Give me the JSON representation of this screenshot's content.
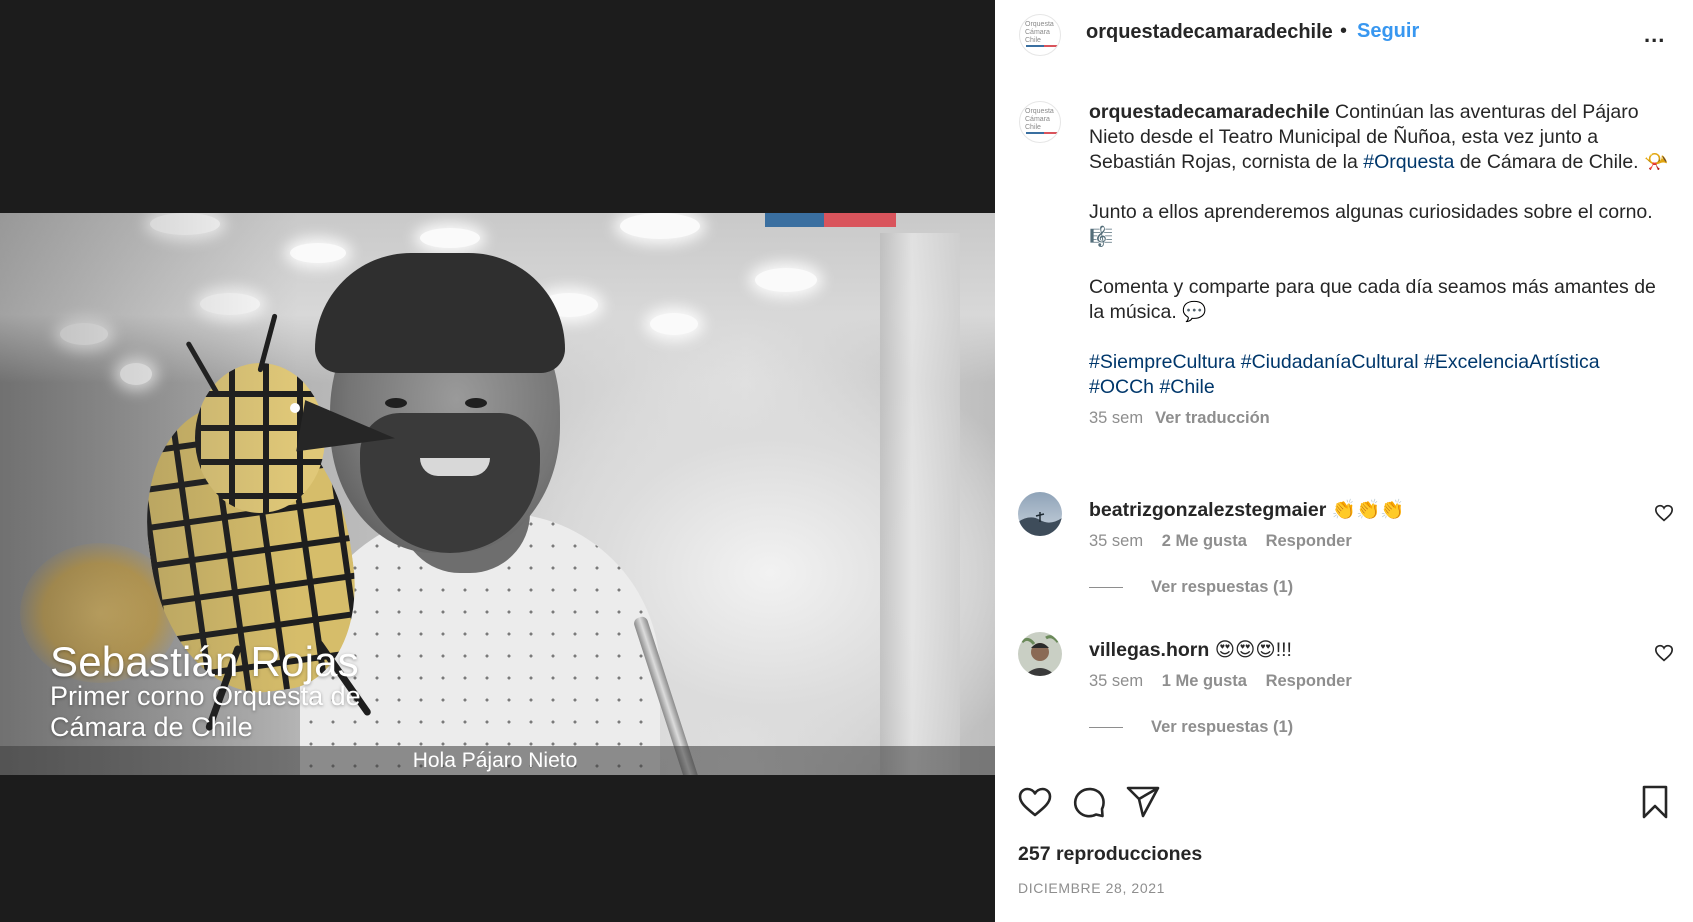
{
  "video": {
    "overlay_name": "Sebastián Rojas",
    "overlay_role": "Primer corno Orquesta de Cámara de Chile",
    "subtitle": "Hola Pájaro Nieto",
    "flag_colors": [
      "#3a6fa0",
      "#d9545c"
    ]
  },
  "header": {
    "username": "orquestadecamaradechile",
    "separator": "•",
    "follow_label": "Seguir",
    "more_label": "...",
    "avatar_logo_lines": [
      "Orquesta",
      "Cámara",
      "Chile"
    ],
    "avatar_icon": "occh-logo-icon"
  },
  "post": {
    "username": "orquestadecamaradechile",
    "paragraph1_text": "Continúan las aventuras del Pájaro Nieto desde el Teatro Municipal de Ñuñoa, esta vez junto a Sebastián Rojas, cornista de la",
    "paragraph1_tag": "#Orquesta",
    "paragraph1_end": "de Cámara de Chile. 📯",
    "paragraph2": "Junto a ellos aprenderemos algunas curiosidades sobre el corno. 🎼",
    "paragraph3": "Comenta y comparte para que cada día seamos más amantes de la música. 💬",
    "hashtags": [
      "#SiempreCultura",
      "#CiudadaníaCultural",
      "#ExcelenciaArtística",
      "#OCCh",
      "#Chile"
    ],
    "time": "35 sem",
    "translate_label": "Ver traducción"
  },
  "comments": [
    {
      "username": "beatrizgonzalezstegmaier",
      "text": "👏👏👏",
      "time": "35 sem",
      "likes": "2 Me gusta",
      "reply_label": "Responder",
      "view_replies": "Ver respuestas (1)"
    },
    {
      "username": "villegas.horn",
      "text": "😍😍😍!!!",
      "time": "35 sem",
      "likes": "1 Me gusta",
      "reply_label": "Responder",
      "view_replies": "Ver respuestas (1)"
    }
  ],
  "footer": {
    "views": "257 reproducciones",
    "date": "DICIEMBRE 28, 2021",
    "icons": [
      "heart-icon",
      "comment-icon",
      "share-icon",
      "bookmark-icon"
    ]
  },
  "colors": {
    "link_blue": "#3897f0",
    "hashtag": "#00376b",
    "muted": "#8e8e8e",
    "text": "#262626",
    "video_bg": "#1c1c1c"
  }
}
